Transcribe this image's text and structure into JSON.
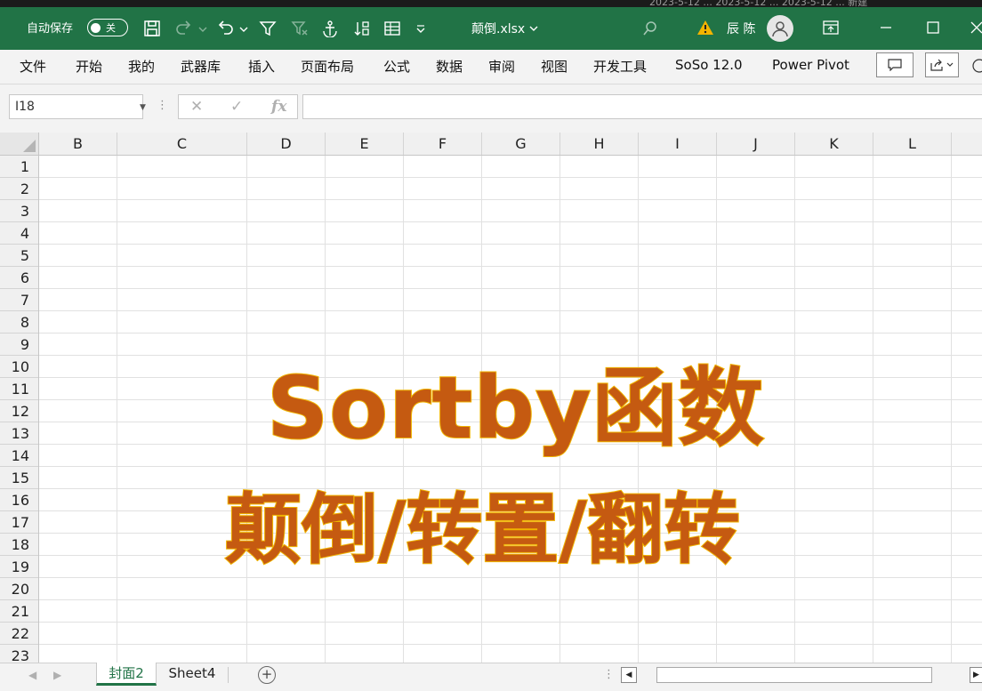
{
  "titlebar": {
    "autosave_label": "自动保存",
    "autosave_state": "关",
    "filename": "颠倒.xlsx",
    "username": "辰 陈",
    "top_strip_text": "2023-5-12 ... 2023-5-12 ... 2023-5-12 ...    新建"
  },
  "ribbon": {
    "tabs": [
      "文件",
      "开始",
      "我的",
      "武器库",
      "插入",
      "页面布局",
      "公式",
      "数据",
      "审阅",
      "视图",
      "开发工具",
      "SoSo 12.0",
      "Power Pivot"
    ]
  },
  "formula_bar": {
    "name_box": "I18",
    "cancel_glyph": "✕",
    "enter_glyph": "✓",
    "fx_label": "fx",
    "formula": ""
  },
  "grid": {
    "columns": [
      "B",
      "C",
      "D",
      "E",
      "F",
      "G",
      "H",
      "I",
      "J",
      "K",
      "L"
    ],
    "rows": [
      "1",
      "2",
      "3",
      "4",
      "5",
      "6",
      "7",
      "8",
      "9",
      "10",
      "11",
      "12",
      "13",
      "14",
      "15",
      "16",
      "17",
      "18",
      "19",
      "20",
      "21",
      "22",
      "23"
    ]
  },
  "wordart": {
    "title": "Sortby函数",
    "subtitle": "颠倒/转置/翻转",
    "fill_color": "#c55a11",
    "outline_color": "#f0b400"
  },
  "sheet_tabs": {
    "active": "封面2",
    "other": "Sheet4",
    "add_glyph": "+"
  },
  "colors": {
    "brand_green": "#217346"
  }
}
